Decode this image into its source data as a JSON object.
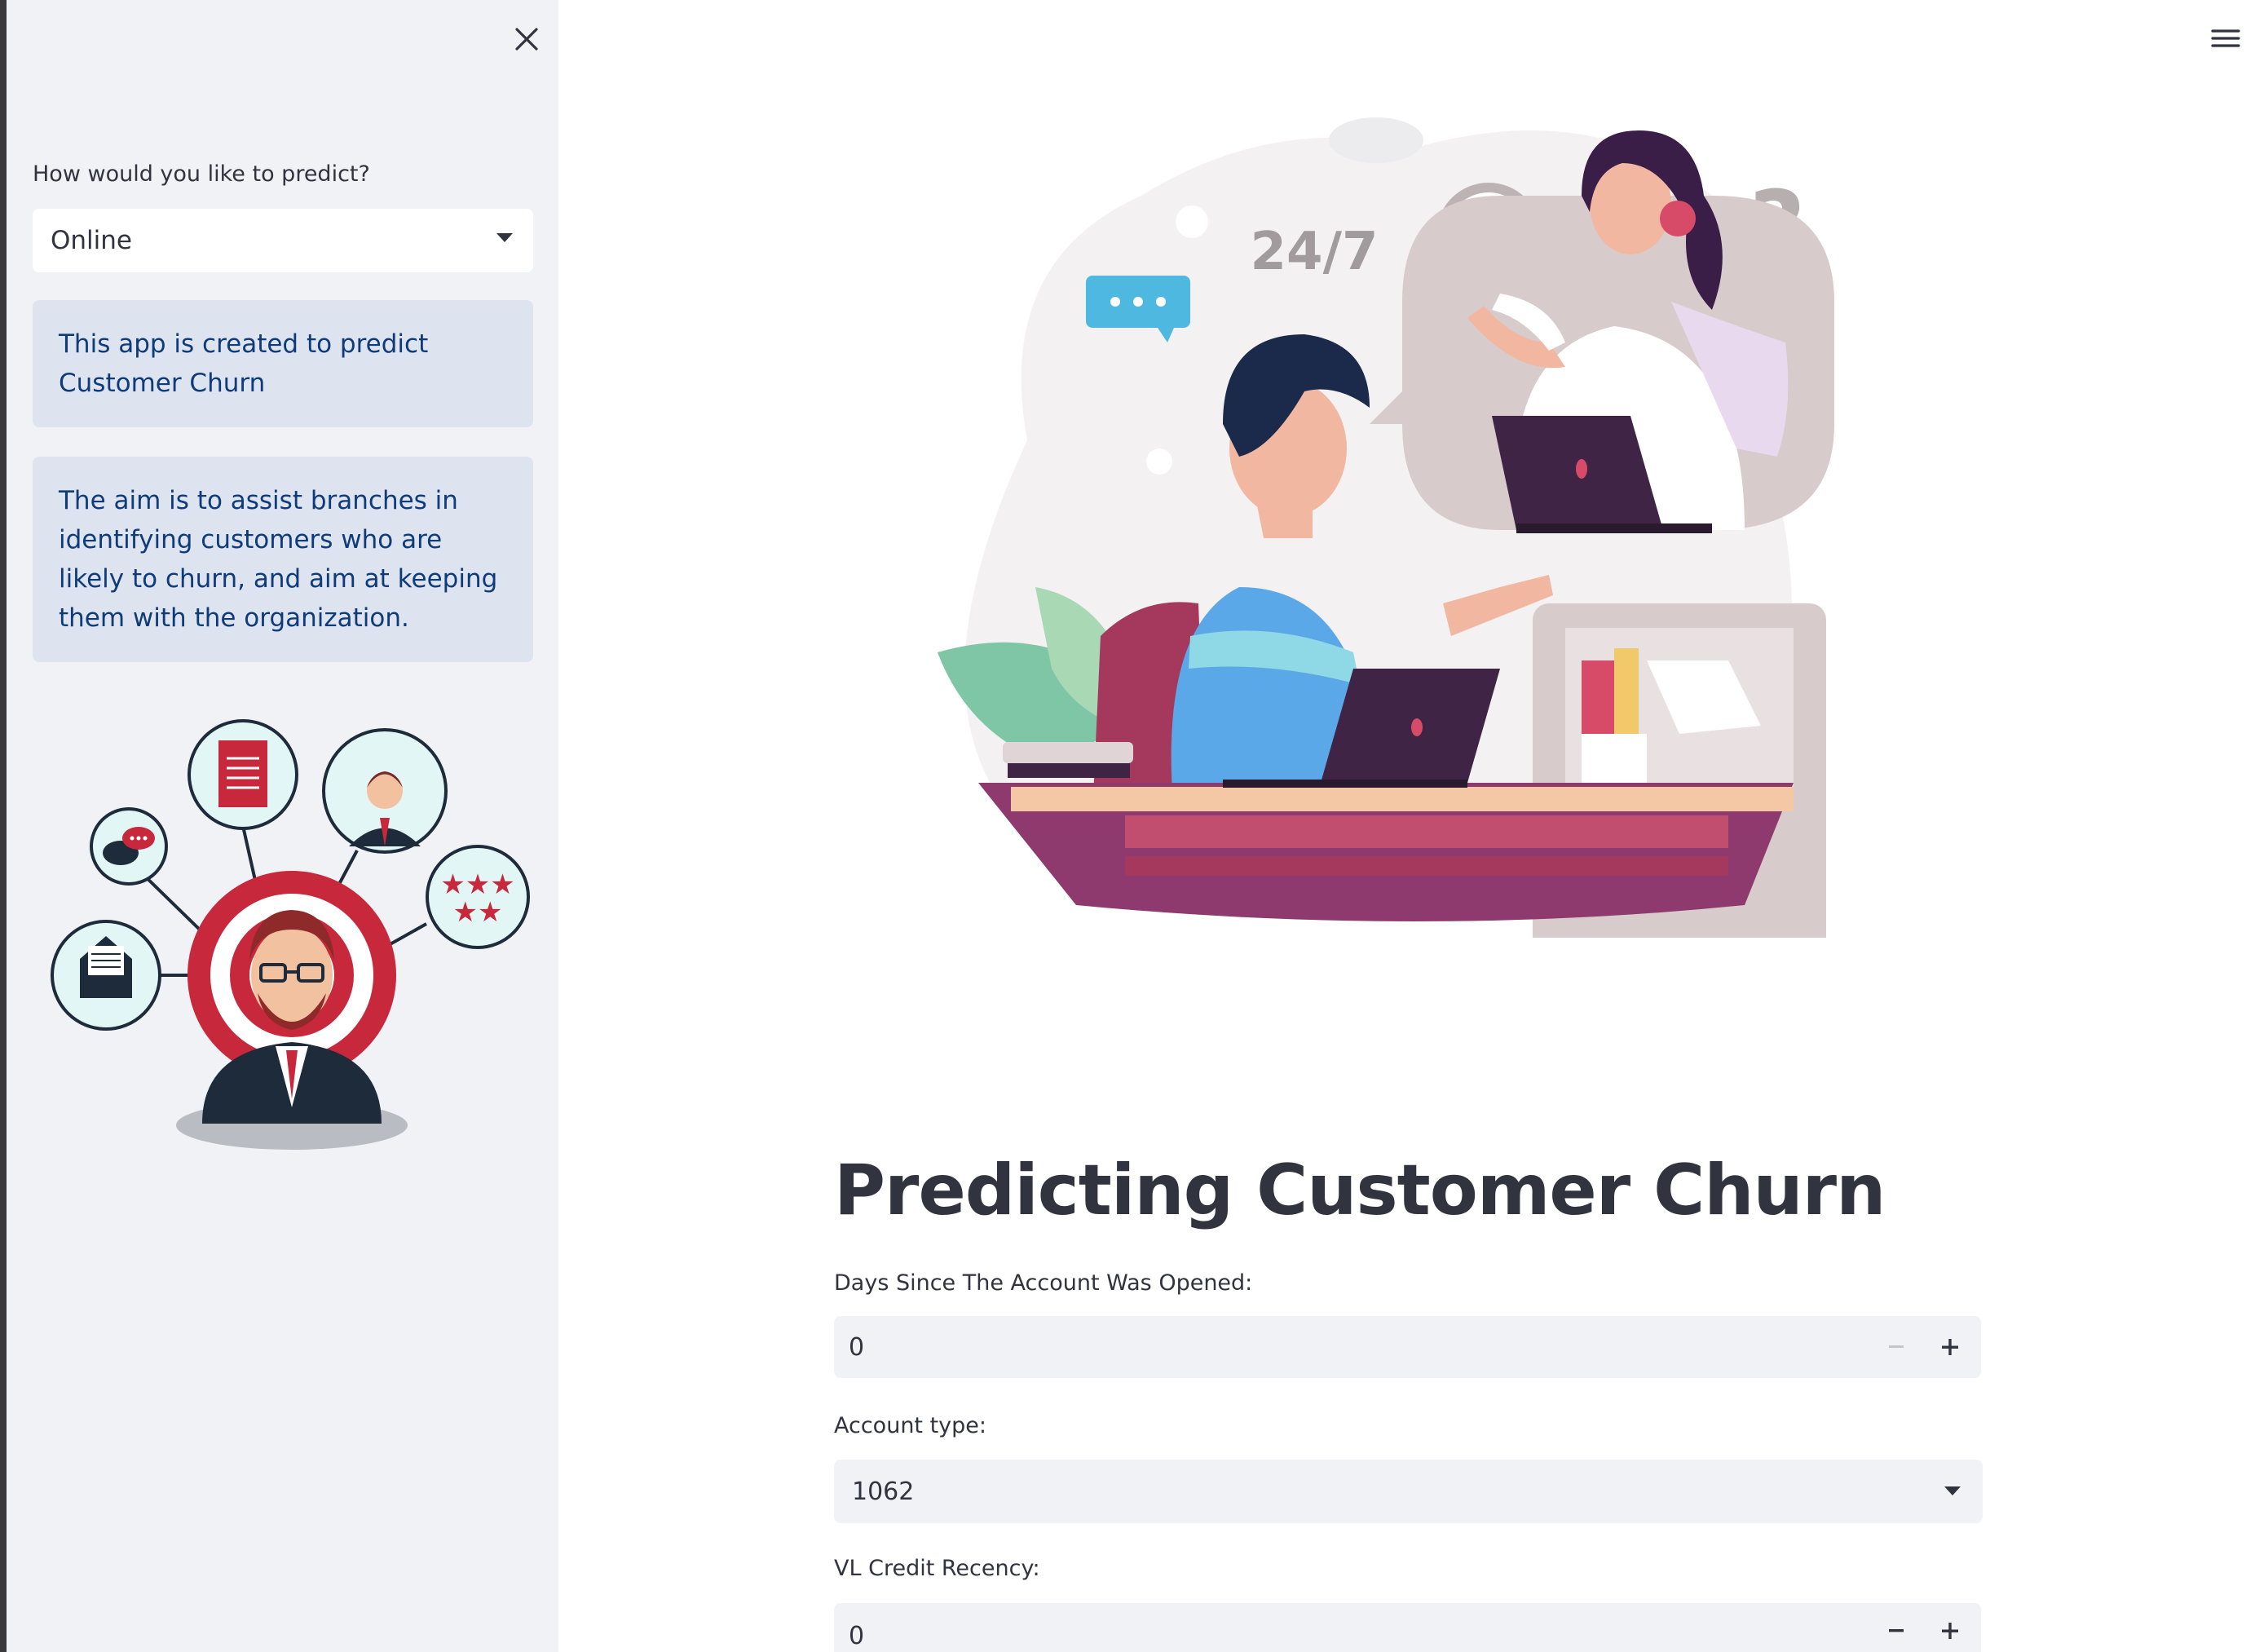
{
  "sidebar": {
    "predict_label": "How would you like to predict?",
    "predict_select": {
      "value": "Online"
    },
    "info_1": "This app is created to predict Customer Churn",
    "info_2": "The aim is to assist branches in identifying customers who are likely to churn, and aim at keeping them with the organization.",
    "illustration": {
      "hero_alt": "businessman-target-icon"
    }
  },
  "main": {
    "hero_illustration": {
      "badge": "24/7",
      "question_mark": "?"
    },
    "title": "Predicting Customer Churn",
    "fields": [
      {
        "label": "Days Since The Account Was Opened:",
        "value": "0"
      },
      {
        "label": "Account type:",
        "value": "1062"
      },
      {
        "label": "VL Credit Recency:",
        "value": "0"
      }
    ]
  },
  "colors": {
    "sidebar_bg": "#f0f2f6",
    "info_bg": "#dde4f0",
    "info_text": "#0f3b78",
    "text": "#31333f",
    "accent_red": "#c8283c"
  }
}
